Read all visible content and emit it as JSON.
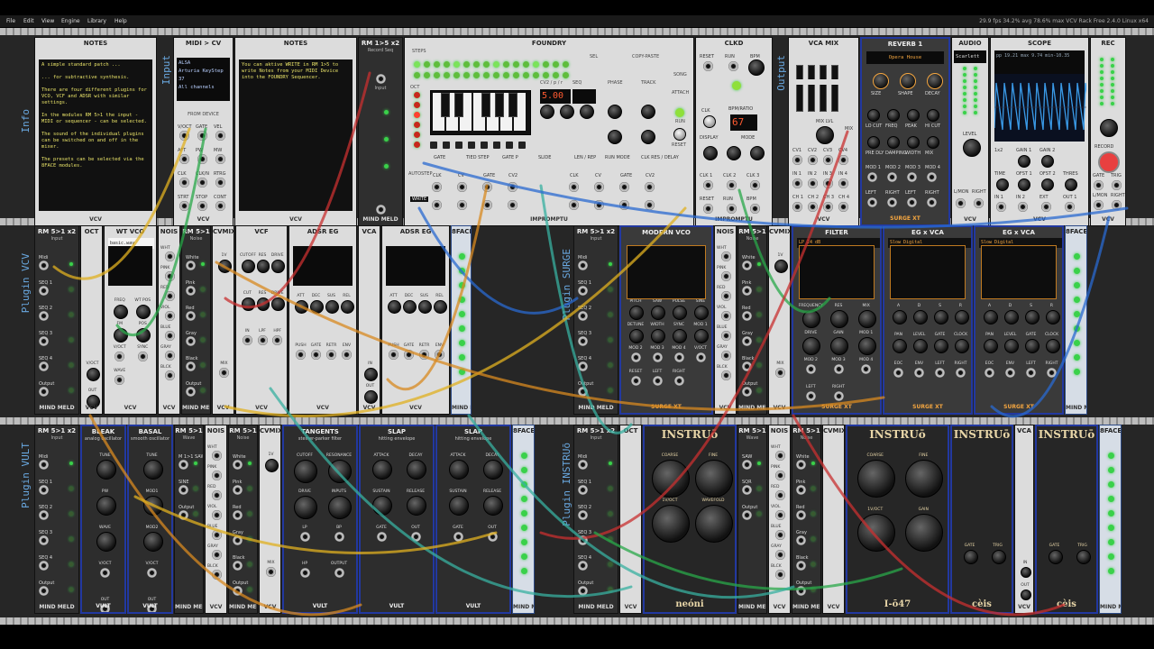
{
  "menu": [
    "File",
    "Edit",
    "View",
    "Engine",
    "Library",
    "Help"
  ],
  "status": "29.9 fps  34.2% avg  78.6% max    VCV Rack Free 2.4.0 Linux x64",
  "section_labels": {
    "info": "Info",
    "input": "Input",
    "output": "Output",
    "vcv": "Plugin VCV",
    "surge": "Plugin SURGE",
    "vult": "Plugin VULT",
    "instruo": "Plugin INSTRUō"
  },
  "notes1": {
    "title": "NOTES",
    "footer": "VCV",
    "text": "A simple standard patch ...\n\n... for subtractive synthesis.\n\nThere are four different plugins for VCO, VCF and ADSR with similar settings.\n\nIn the modules RM 5>1 the input - MIDI or sequencer - can be selected.\n\nThe sound of the individual plugins can be switched on and off in the mixer.\n\nThe presets can be selected via the 8FACE modules."
  },
  "midi": {
    "title": "MIDI > CV",
    "footer": "VCV",
    "lines": [
      "ALSA",
      "Arturia KeyStep 37",
      "All channels"
    ],
    "from": "FROM DEVICE",
    "jacks": [
      "V/OCT",
      "GATE",
      "VEL",
      "AFT",
      "PW",
      "MW",
      "CLK",
      "CLK/N",
      "RTRG",
      "STRT",
      "STOP",
      "CONT"
    ]
  },
  "notes2": {
    "title": "NOTES",
    "footer": "VCV",
    "text": "You can aktive WRITE in RM 1>5 to write Notes from your MIDI Device into the FOUNDRY Sequencer."
  },
  "rm15": {
    "title": "RM 1>5 x2",
    "sub": "Record Seq",
    "footer": "MIND MELD",
    "input": "Input"
  },
  "foundry": {
    "title": "FOUNDRY",
    "footer": "IMPROMPTU",
    "steps": "STEPS",
    "oct": "OCT",
    "display": "5.00",
    "cv2": "CV2 / p / r",
    "seq": "SEQ",
    "phase": "PHASE",
    "track": "TRACK",
    "labels": [
      "GATE",
      "TIED STEP",
      "GATE P",
      "SLIDE",
      "LEN / REP",
      "RUN MODE",
      "CLK RES / DELAY"
    ],
    "copy": "COPY-PASTE",
    "sel": "SEL",
    "song": "SONG",
    "attach": "ATTACH",
    "run": "RUN",
    "reset": "RESET",
    "autostep": "AUTOSTEP",
    "write": "WRITE",
    "bottom": [
      "CLK",
      "CV",
      "GATE",
      "CV2",
      "CLK",
      "CV",
      "GATE",
      "CV2"
    ]
  },
  "clkd": {
    "title": "CLKD",
    "footer": "IMPROMPTU",
    "labels": [
      "RESET",
      "RUN",
      "BPM",
      "CLK",
      "BPM/RATIO",
      "DISPLAY",
      "MODE",
      "CLK 1",
      "CLK 2",
      "CLK 3",
      "RESET",
      "RUN",
      "BPM"
    ],
    "bpm": "67"
  },
  "vcamix": {
    "title": "VCA MIX",
    "footer": "VCV",
    "labels": [
      "MIX LVL",
      "CV1",
      "CV2",
      "CV3",
      "CV4",
      "MIX",
      "IN 1",
      "IN 2",
      "IN 3",
      "IN 4",
      "CH 1",
      "CH 2",
      "CH 3",
      "CH 4"
    ]
  },
  "reverb": {
    "title": "REVERB 1",
    "preset": "Opera House",
    "footer": "SURGE XT",
    "labels": [
      "SIZE",
      "SHAPE",
      "DECAY",
      "LO CUT",
      "FREQ",
      "PEAK",
      "HI CUT",
      "PRE DLY",
      "DAMPING",
      "WIDTH",
      "MIX",
      "MOD 1",
      "MOD 2",
      "MOD 3",
      "MOD 4",
      "LEFT",
      "RIGHT",
      "LEFT",
      "RIGHT"
    ]
  },
  "audio": {
    "title": "AUDIO",
    "device": "Scarlett 2i",
    "footer": "VCV",
    "labels": [
      "LEVEL",
      "L/MON",
      "RIGHT"
    ]
  },
  "scope": {
    "title": "SCOPE",
    "readout": "pp  19.21 max  9.74 min-10.35",
    "footer": "VCV",
    "labels": [
      "1x2",
      "GAIN 1",
      "GAIN 2",
      "TIME",
      "OFST 1",
      "OFST 2",
      "THRES",
      "IN 1",
      "IN 2",
      "EXT",
      "OUT 1",
      "OUT 2"
    ]
  },
  "rec": {
    "title": "REC",
    "footer": "VCV",
    "labels": [
      "RECORD",
      "GATE",
      "TRIG",
      "L/MON",
      "RIGHT"
    ]
  },
  "row2": {
    "rm_a": {
      "title": "RM 5>1 x2",
      "sub": "Input",
      "labels": [
        "Midi",
        "SEQ 1",
        "SEQ 2",
        "SEQ 3",
        "SEQ 4",
        "Output"
      ],
      "footer": "MIND MELD"
    },
    "oct": {
      "title": "OCT",
      "footer": "VCV",
      "labels": [
        "V/OCT",
        "OUT"
      ]
    },
    "wtvco": {
      "title": "WT VCO",
      "file": "basic.wav",
      "footer": "VCV",
      "labels": [
        "FREQ",
        "WT POS",
        "FM",
        "POS",
        "V/OCT",
        "SYNC",
        "WAVE"
      ]
    },
    "nois": {
      "title": "NOIS",
      "footer": "VCV",
      "labels": [
        "WHT",
        "PINK",
        "RED",
        "VIOL",
        "BLUE",
        "GRAY",
        "BLCK"
      ]
    },
    "rm_b": {
      "title": "RM 5>1",
      "sub": "Noise",
      "labels": [
        "White",
        "Pink",
        "Red",
        "Gray",
        "Black",
        "Output"
      ],
      "footer": "MIND MELD"
    },
    "cvmix": {
      "title": "CVMIX",
      "footer": "VCV",
      "labels": [
        "1V",
        "MIX"
      ]
    },
    "vcf": {
      "title": "VCF",
      "footer": "VCV",
      "labels": [
        "CUTOFF",
        "RES",
        "DRIVE",
        "CUT",
        "RES",
        "DRIVE",
        "IN",
        "LPF",
        "HPF"
      ]
    },
    "adsr1": {
      "title": "ADSR EG",
      "footer": "VCV",
      "labels": [
        "ATT",
        "DEC",
        "SUS",
        "REL",
        "PUSH",
        "GATE",
        "RETR",
        "ENV"
      ]
    },
    "vca": {
      "title": "VCA",
      "footer": "VCV",
      "labels": [
        "IN",
        "OUT"
      ]
    },
    "adsr2": {
      "title": "ADSR EG",
      "footer": "VCV",
      "labels": [
        "ATT",
        "DEC",
        "SUS",
        "REL",
        "PUSH",
        "GATE",
        "RETR",
        "ENV"
      ]
    },
    "bface": {
      "title": "8FACE",
      "footer": "MIND MELD"
    },
    "rm_c": {
      "title": "RM 5>1 x2",
      "sub": "Input",
      "labels": [
        "Midi",
        "SEQ 1",
        "SEQ 2",
        "SEQ 3",
        "SEQ 4",
        "Output"
      ],
      "footer": "MIND MELD"
    },
    "modvco": {
      "title": "MODERN VCO",
      "footer": "SURGE XT",
      "labels": [
        "PITCH",
        "SAW",
        "PULSE",
        "SINE",
        "DETUNE",
        "WIDTH",
        "SYNC",
        "MOD 1",
        "MOD 2",
        "MOD 3",
        "MOD 4",
        "V/OCT",
        "RESET",
        "LEFT",
        "RIGHT"
      ]
    },
    "nois2": {
      "title": "NOIS",
      "footer": "VCV",
      "labels": [
        "WHT",
        "PINK",
        "RED",
        "VIOL",
        "BLUE",
        "GRAY",
        "BLCK"
      ]
    },
    "rm_d": {
      "title": "RM 5>1",
      "sub": "Noise",
      "labels": [
        "White",
        "Pink",
        "Red",
        "Gray",
        "Black",
        "Output"
      ],
      "footer": "MIND MELD"
    },
    "cvmix2": {
      "title": "CVMIX",
      "footer": "VCV",
      "labels": [
        "1V",
        "MIX"
      ]
    },
    "filter": {
      "title": "FILTER",
      "mode": "LP 24 dB",
      "sub": "Standard",
      "footer": "SURGE XT",
      "labels": [
        "FREQUENCY",
        "RES",
        "MIX",
        "DRIVE",
        "GAIN",
        "MOD 1",
        "MOD 2",
        "MOD 3",
        "MOD 4",
        "LEFT",
        "RIGHT"
      ]
    },
    "egvca1": {
      "title": "EG x VCA",
      "mode": "Slow Digital",
      "footer": "SURGE XT",
      "labels": [
        "A",
        "D",
        "S",
        "R",
        "PAN",
        "LEVEL",
        "GATE",
        "CLOCK",
        "EOC",
        "ENV",
        "LEFT",
        "RIGHT"
      ]
    },
    "egvca2": {
      "title": "EG x VCA",
      "mode": "Slow Digital",
      "footer": "SURGE XT",
      "labels": [
        "A",
        "D",
        "S",
        "R",
        "PAN",
        "LEVEL",
        "GATE",
        "CLOCK",
        "EOC",
        "ENV",
        "LEFT",
        "RIGHT"
      ]
    },
    "bface2": {
      "title": "8FACE",
      "footer": "MIND MELD"
    }
  },
  "row3": {
    "rm_e": {
      "title": "RM 5>1 x2",
      "sub": "Input",
      "labels": [
        "Midi",
        "SEQ 1",
        "SEQ 2",
        "SEQ 3",
        "SEQ 4",
        "Output"
      ],
      "footer": "MIND MELD"
    },
    "bleak": {
      "title": "BLEAK",
      "sub": "analog oscillator",
      "footer": "VULT",
      "labels": [
        "TUNE",
        "PW",
        "WAVE",
        "V/OCT",
        "OUT"
      ]
    },
    "basal": {
      "title": "BASAL",
      "sub": "smooth oscillator",
      "footer": "VULT",
      "labels": [
        "TUNE",
        "MOD1",
        "MOD2",
        "V/OCT",
        "OUT"
      ]
    },
    "rm_f": {
      "title": "RM 5>1",
      "sub": "Wave",
      "labels": [
        "M 1>1 SAW",
        "SINE",
        "Output"
      ],
      "footer": "MIND MELD"
    },
    "nois3": {
      "title": "NOIS",
      "footer": "VCV",
      "labels": [
        "WHT",
        "PINK",
        "RED",
        "VIOL",
        "BLUE",
        "GRAY",
        "BLCK"
      ]
    },
    "rm_g": {
      "title": "RM 5>1",
      "sub": "Noise",
      "labels": [
        "White",
        "Pink",
        "Red",
        "Gray",
        "Black",
        "Output"
      ],
      "footer": "MIND MELD"
    },
    "cvmix3": {
      "title": "CVMIX",
      "footer": "VCV",
      "labels": [
        "1V",
        "MIX"
      ]
    },
    "tangents": {
      "title": "TANGENTS",
      "sub": "steiner-parker filter",
      "footer": "VULT",
      "labels": [
        "CUTOFF",
        "RESONANCE",
        "DRIVE",
        "INPUTS",
        "LP",
        "BP",
        "HP",
        "OUTPUT"
      ]
    },
    "slap1": {
      "title": "SLAP",
      "sub": "hitting envelope",
      "footer": "VULT",
      "labels": [
        "ATTACK",
        "DECAY",
        "SUSTAIN",
        "RELEASE",
        "GATE",
        "OUT"
      ]
    },
    "slap2": {
      "title": "SLAP",
      "sub": "hitting envelope",
      "footer": "VULT",
      "labels": [
        "ATTACK",
        "DECAY",
        "SUSTAIN",
        "RELEASE",
        "GATE",
        "OUT"
      ]
    },
    "bface3": {
      "title": "8FACE",
      "footer": "MIND MELD"
    },
    "rm_h": {
      "title": "RM 5>1 x2",
      "sub": "Input",
      "labels": [
        "Midi",
        "SEQ 1",
        "SEQ 2",
        "SEQ 3",
        "SEQ 4",
        "Output"
      ],
      "footer": "MIND MELD"
    },
    "oct2": {
      "title": "OCT",
      "footer": "VCV"
    },
    "neoni": {
      "title": "INSTRUō",
      "footer": "neóni",
      "labels": [
        "COARSE",
        "FINE",
        "1V/OCT",
        "WAVEFOLD"
      ]
    },
    "rm_i": {
      "title": "RM 5>1",
      "sub": "Wave",
      "labels": [
        "SAW",
        "SQR",
        "Output"
      ],
      "footer": "MIND MELD"
    },
    "nois4": {
      "title": "NOIS",
      "footer": "VCV",
      "labels": [
        "WHT",
        "PINK",
        "RED",
        "VIOL",
        "BLUE",
        "GRAY",
        "BLCK"
      ]
    },
    "rm_j": {
      "title": "RM 5>1",
      "sub": "Noise",
      "labels": [
        "White",
        "Pink",
        "Red",
        "Gray",
        "Black",
        "Output"
      ],
      "footer": "MIND MELD"
    },
    "cvmix4": {
      "title": "CVMIX",
      "footer": "VCV"
    },
    "i047": {
      "title": "INSTRUō",
      "footer": "I-ō47",
      "labels": [
        "COARSE",
        "FINE",
        "1V/OCT",
        "GAIN"
      ]
    },
    "ceis1": {
      "title": "INSTRUō",
      "footer": "cèis",
      "labels": [
        "GATE",
        "TRIG"
      ]
    },
    "vca2": {
      "title": "VCA",
      "footer": "VCV",
      "labels": [
        "IN",
        "OUT"
      ]
    },
    "ceis2": {
      "title": "INSTRUō",
      "footer": "cèis",
      "labels": [
        "GATE",
        "TRIG"
      ]
    },
    "bface4": {
      "title": "8FACE",
      "footer": "MIND MELD"
    }
  },
  "colors": {
    "accent": "#2238a0",
    "notes_text": "#e8e268",
    "scope_trace": "#3a9ae8",
    "surge_orange": "#f4a640"
  }
}
